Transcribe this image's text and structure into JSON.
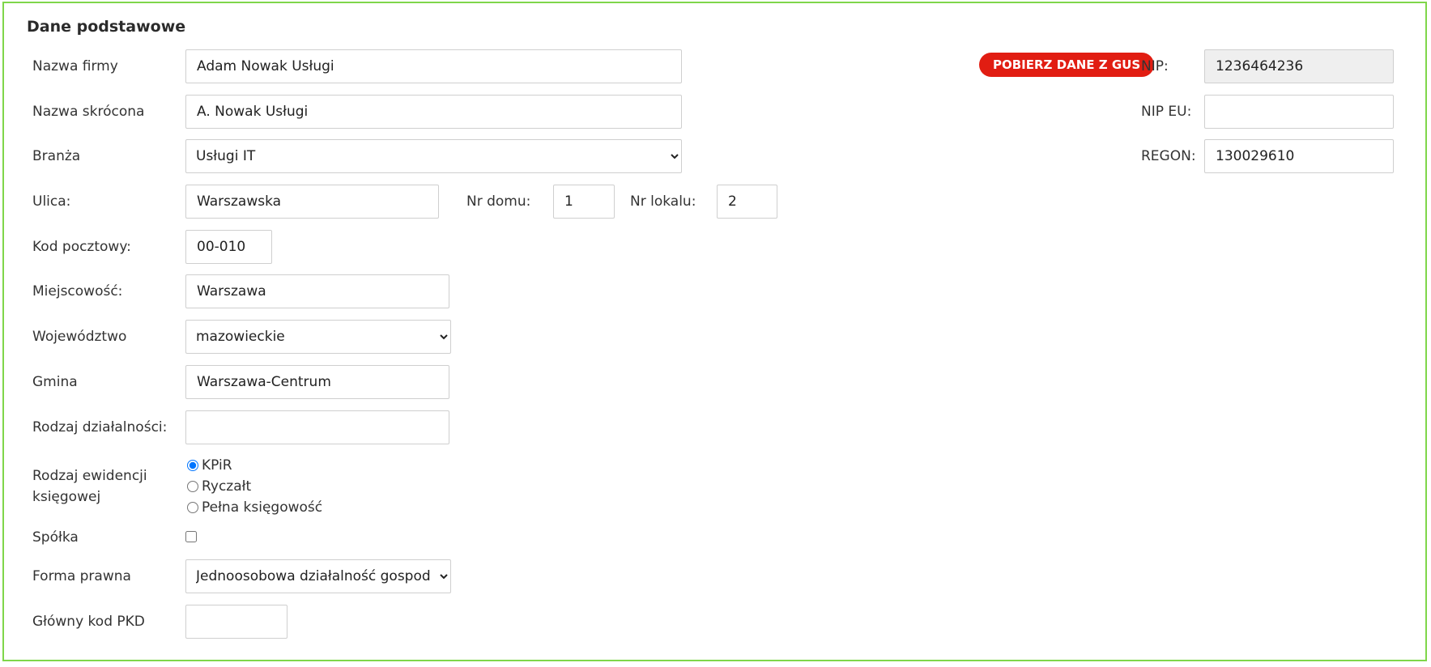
{
  "section": {
    "title": "Dane podstawowe"
  },
  "gus_button": {
    "label": "POBIERZ DANE Z GUS"
  },
  "fields": {
    "nazwa_firmy": {
      "label": "Nazwa firmy",
      "value": "Adam Nowak Usługi"
    },
    "nazwa_skrocona": {
      "label": "Nazwa skrócona",
      "value": "A. Nowak Usługi"
    },
    "branza": {
      "label": "Branża",
      "value": "Usługi IT"
    },
    "ulica": {
      "label": "Ulica:",
      "value": "Warszawska"
    },
    "nr_domu": {
      "label": "Nr domu:",
      "value": "1"
    },
    "nr_lokalu": {
      "label": "Nr lokalu:",
      "value": "2"
    },
    "kod_pocztowy": {
      "label": "Kod pocztowy:",
      "value": "00-010"
    },
    "miejscowosc": {
      "label": "Miejscowość:",
      "value": "Warszawa"
    },
    "wojewodztwo": {
      "label": "Województwo",
      "value": "mazowieckie"
    },
    "gmina": {
      "label": "Gmina",
      "value": "Warszawa-Centrum"
    },
    "rodzaj_dzialalnosci": {
      "label": "Rodzaj działalności:",
      "value": ""
    },
    "ewidencja": {
      "label_line1": "Rodzaj ewidencji",
      "label_line2": "księgowej",
      "options": [
        "KPiR",
        "Ryczałt",
        "Pełna księgowość"
      ],
      "selected": "KPiR"
    },
    "spolka": {
      "label": "Spółka",
      "checked": false
    },
    "forma_prawna": {
      "label": "Forma prawna",
      "value": "Jednoosobowa działalność gospodarcza"
    },
    "pkd": {
      "label": "Główny kod PKD",
      "value": ""
    },
    "nip": {
      "label": "NIP:",
      "value": "1236464236"
    },
    "nip_eu": {
      "label": "NIP EU:",
      "value": ""
    },
    "regon": {
      "label": "REGON:",
      "value": "130029610"
    }
  },
  "colors": {
    "border": "#7fd64a",
    "button": "#e11d12",
    "readonly_bg": "#efefef"
  }
}
